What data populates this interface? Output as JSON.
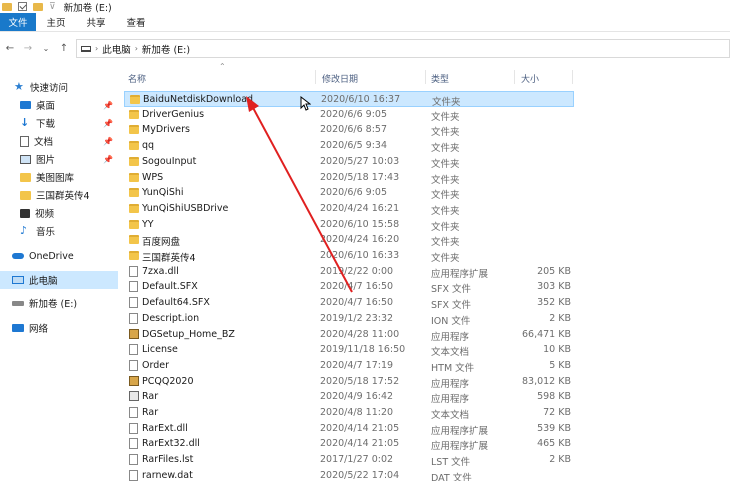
{
  "title": "新加卷 (E:)",
  "ribbon": {
    "tabs": [
      "文件",
      "主页",
      "共享",
      "查看"
    ]
  },
  "nav": {
    "back": "←",
    "forward": "→",
    "recent": "⌄",
    "up": "↑"
  },
  "address": {
    "crumbs": [
      "此电脑",
      "新加卷 (E:)"
    ]
  },
  "sidebar": {
    "items": [
      {
        "label": "快速访问",
        "icon": "star-icon"
      },
      {
        "label": "桌面",
        "icon": "desktop-icon",
        "pinned": true
      },
      {
        "label": "下载",
        "icon": "download-icon",
        "pinned": true
      },
      {
        "label": "文档",
        "icon": "document-icon",
        "pinned": true
      },
      {
        "label": "图片",
        "icon": "picture-icon",
        "pinned": true
      },
      {
        "label": "美图图库",
        "icon": "folder-icon"
      },
      {
        "label": "三国群英传4",
        "icon": "folder-icon"
      },
      {
        "label": "视频",
        "icon": "video-icon"
      },
      {
        "label": "音乐",
        "icon": "music-icon"
      },
      {
        "label": "OneDrive",
        "icon": "cloud-icon"
      },
      {
        "label": "此电脑",
        "icon": "computer-icon",
        "selected": true
      },
      {
        "label": "新加卷 (E:)",
        "icon": "drive-icon"
      },
      {
        "label": "网络",
        "icon": "network-icon"
      }
    ]
  },
  "columns": {
    "name": "名称",
    "date": "修改日期",
    "type": "类型",
    "size": "大小"
  },
  "files": [
    {
      "name": "BaiduNetdiskDownload",
      "date": "2020/6/10 16:37",
      "type": "文件夹",
      "size": "",
      "kind": "folder",
      "selected": true
    },
    {
      "name": "DriverGenius",
      "date": "2020/6/6 9:05",
      "type": "文件夹",
      "size": "",
      "kind": "folder"
    },
    {
      "name": "MyDrivers",
      "date": "2020/6/6 8:57",
      "type": "文件夹",
      "size": "",
      "kind": "folder"
    },
    {
      "name": "qq",
      "date": "2020/6/5 9:34",
      "type": "文件夹",
      "size": "",
      "kind": "folder"
    },
    {
      "name": "SogouInput",
      "date": "2020/5/27 10:03",
      "type": "文件夹",
      "size": "",
      "kind": "folder"
    },
    {
      "name": "WPS",
      "date": "2020/5/18 17:43",
      "type": "文件夹",
      "size": "",
      "kind": "folder"
    },
    {
      "name": "YunQiShi",
      "date": "2020/6/6 9:05",
      "type": "文件夹",
      "size": "",
      "kind": "folder"
    },
    {
      "name": "YunQiShiUSBDrive",
      "date": "2020/4/24 16:21",
      "type": "文件夹",
      "size": "",
      "kind": "folder"
    },
    {
      "name": "YY",
      "date": "2020/6/10 15:58",
      "type": "文件夹",
      "size": "",
      "kind": "folder"
    },
    {
      "name": "百度网盘",
      "date": "2020/4/24 16:20",
      "type": "文件夹",
      "size": "",
      "kind": "folder"
    },
    {
      "name": "三国群英传4",
      "date": "2020/6/10 16:33",
      "type": "文件夹",
      "size": "",
      "kind": "folder"
    },
    {
      "name": "7zxa.dll",
      "date": "2019/2/22 0:00",
      "type": "应用程序扩展",
      "size": "205 KB",
      "kind": "file"
    },
    {
      "name": "Default.SFX",
      "date": "2020/4/7 16:50",
      "type": "SFX 文件",
      "size": "303 KB",
      "kind": "file"
    },
    {
      "name": "Default64.SFX",
      "date": "2020/4/7 16:50",
      "type": "SFX 文件",
      "size": "352 KB",
      "kind": "file"
    },
    {
      "name": "Descript.ion",
      "date": "2019/1/2 23:32",
      "type": "ION 文件",
      "size": "2 KB",
      "kind": "file"
    },
    {
      "name": "DGSetup_Home_BZ",
      "date": "2020/4/28 11:00",
      "type": "应用程序",
      "size": "66,471 KB",
      "kind": "appc"
    },
    {
      "name": "License",
      "date": "2019/11/18 16:50",
      "type": "文本文档",
      "size": "10 KB",
      "kind": "file"
    },
    {
      "name": "Order",
      "date": "2020/4/7 17:19",
      "type": "HTM 文件",
      "size": "5 KB",
      "kind": "file"
    },
    {
      "name": "PCQQ2020",
      "date": "2020/5/18 17:52",
      "type": "应用程序",
      "size": "83,012 KB",
      "kind": "appc"
    },
    {
      "name": "Rar",
      "date": "2020/4/9 16:42",
      "type": "应用程序",
      "size": "598 KB",
      "kind": "app"
    },
    {
      "name": "Rar",
      "date": "2020/4/8 11:20",
      "type": "文本文档",
      "size": "72 KB",
      "kind": "file"
    },
    {
      "name": "RarExt.dll",
      "date": "2020/4/14 21:05",
      "type": "应用程序扩展",
      "size": "539 KB",
      "kind": "file"
    },
    {
      "name": "RarExt32.dll",
      "date": "2020/4/14 21:05",
      "type": "应用程序扩展",
      "size": "465 KB",
      "kind": "file"
    },
    {
      "name": "RarFiles.lst",
      "date": "2017/1/27 0:02",
      "type": "LST 文件",
      "size": "2 KB",
      "kind": "file"
    },
    {
      "name": "rarnew.dat",
      "date": "2020/5/22 17:04",
      "type": "DAT 文件",
      "size": "",
      "kind": "file"
    }
  ],
  "colors": {
    "accent": "#1979ca",
    "selection": "#cce8ff",
    "arrow": "#e02020"
  }
}
